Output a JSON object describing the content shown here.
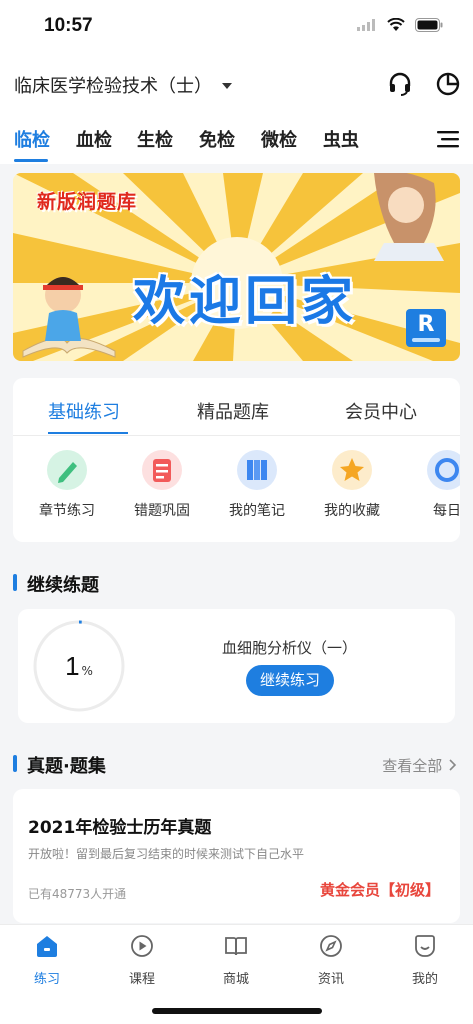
{
  "status_bar": {
    "time": "10:57"
  },
  "header": {
    "subject": "临床医学检验技术（士）",
    "tabs": [
      {
        "label": "临检",
        "active": true
      },
      {
        "label": "血检",
        "active": false
      },
      {
        "label": "生检",
        "active": false
      },
      {
        "label": "免检",
        "active": false
      },
      {
        "label": "微检",
        "active": false
      },
      {
        "label": "虫虫",
        "active": false
      }
    ]
  },
  "banner": {
    "tag": "新版润题库",
    "title": "欢迎回家",
    "logo": "R"
  },
  "practice": {
    "tabs": [
      "基础练习",
      "精品题库",
      "会员中心"
    ],
    "shortcuts": [
      {
        "label": "章节练习",
        "icon": "pencil-icon",
        "color": "#3fbf7f"
      },
      {
        "label": "错题巩固",
        "icon": "error-list-icon",
        "color": "#f25a5a"
      },
      {
        "label": "我的笔记",
        "icon": "notebook-icon",
        "color": "#3d87f0"
      },
      {
        "label": "我的收藏",
        "icon": "star-icon",
        "color": "#f5a623"
      },
      {
        "label": "每日",
        "icon": "daily-icon",
        "color": "#3d87f0"
      }
    ]
  },
  "continue_section": {
    "title": "继续练题",
    "progress_value": "1",
    "progress_unit": "%",
    "progress_fraction": 0.01,
    "device": "血细胞分析仪（一）",
    "button": "继续练习"
  },
  "exam_section": {
    "title": "真题·题集",
    "view_all": "查看全部",
    "card": {
      "title": "2021年检验士历年真题",
      "desc": "开放啦！留到最后复习结束的时候来测试下自己水平",
      "count": "已有48773人开通",
      "member": "黄金会员【初级】"
    }
  },
  "bottom_nav": [
    {
      "label": "练习",
      "icon": "home-icon",
      "active": true
    },
    {
      "label": "课程",
      "icon": "play-icon",
      "active": false
    },
    {
      "label": "商城",
      "icon": "book-icon",
      "active": false
    },
    {
      "label": "资讯",
      "icon": "compass-icon",
      "active": false
    },
    {
      "label": "我的",
      "icon": "profile-icon",
      "active": false
    }
  ],
  "colors": {
    "accent": "#1e7ee0",
    "member": "#e8463c"
  }
}
